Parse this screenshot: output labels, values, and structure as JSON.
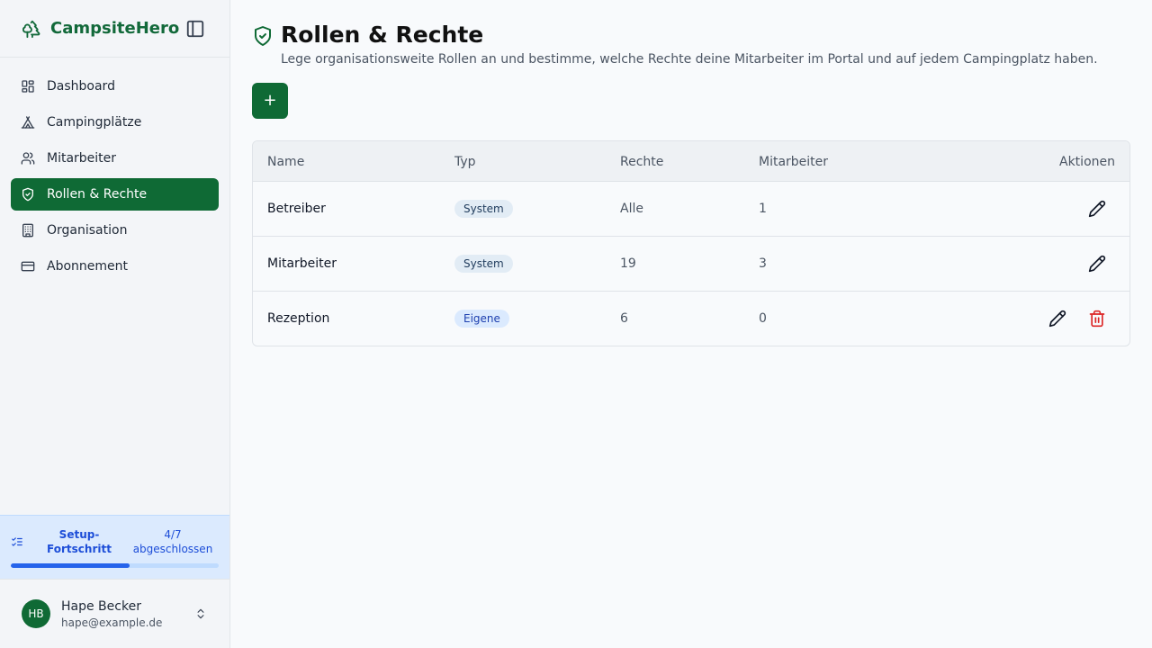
{
  "app": {
    "name": "CampsiteHero"
  },
  "sidebar": {
    "items": [
      {
        "label": "Dashboard",
        "icon": "dashboard-icon",
        "active": false
      },
      {
        "label": "Campingplätze",
        "icon": "tent-icon",
        "active": false
      },
      {
        "label": "Mitarbeiter",
        "icon": "users-icon",
        "active": false
      },
      {
        "label": "Rollen & Rechte",
        "icon": "shield-check-icon",
        "active": true
      },
      {
        "label": "Organisation",
        "icon": "building-icon",
        "active": false
      },
      {
        "label": "Abonnement",
        "icon": "credit-card-icon",
        "active": false
      }
    ],
    "setup": {
      "title": "Setup-Fortschritt",
      "count": "4/7 abgeschlossen",
      "progress": 0.57
    },
    "user": {
      "initials": "HB",
      "name": "Hape Becker",
      "email": "hape@example.de"
    }
  },
  "main": {
    "title": "Rollen & Rechte",
    "description": "Lege organisationsweite Rollen an und bestimme, welche Rechte deine Mitarbeiter im Portal und auf jedem Campingplatz haben.",
    "add_label": "+",
    "table": {
      "headers": {
        "name": "Name",
        "type": "Typ",
        "rights": "Rechte",
        "staff": "Mitarbeiter",
        "actions": "Aktionen"
      },
      "rows": [
        {
          "name": "Betreiber",
          "type": "System",
          "rights": "Alle",
          "staff": "1",
          "deletable": false
        },
        {
          "name": "Mitarbeiter",
          "type": "System",
          "rights": "19",
          "staff": "3",
          "deletable": false
        },
        {
          "name": "Rezeption",
          "type": "Eigene",
          "rights": "6",
          "staff": "0",
          "deletable": true
        }
      ]
    }
  },
  "colors": {
    "brand": "#0f6a35",
    "accent": "#2563eb",
    "danger": "#dc2626"
  }
}
